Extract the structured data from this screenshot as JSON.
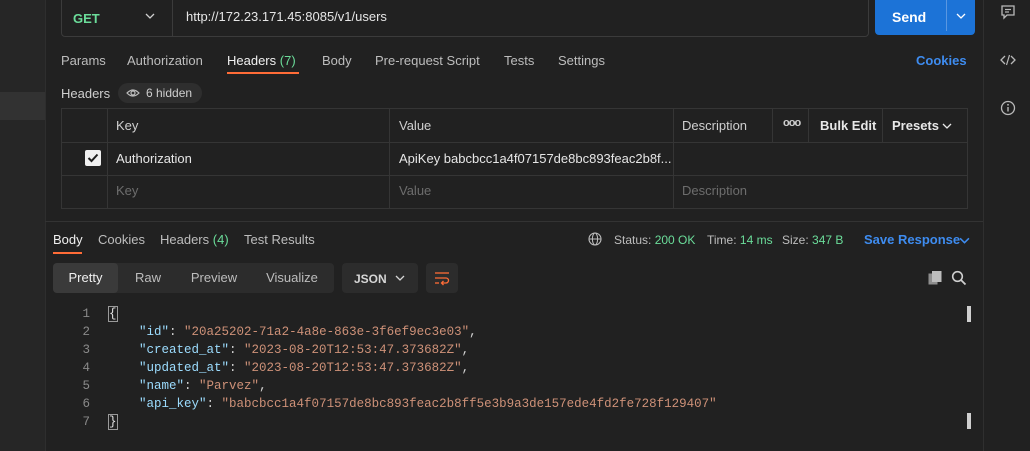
{
  "request": {
    "method": "GET",
    "url": "http://172.23.171.45:8085/v1/users",
    "send_label": "Send",
    "tabs": [
      {
        "label": "Params"
      },
      {
        "label": "Authorization"
      },
      {
        "label": "Headers",
        "count": "(7)"
      },
      {
        "label": "Body"
      },
      {
        "label": "Pre-request Script"
      },
      {
        "label": "Tests"
      },
      {
        "label": "Settings"
      }
    ],
    "cookies_label": "Cookies"
  },
  "headers_section": {
    "title": "Headers",
    "hidden_label": "6 hidden",
    "columns": {
      "key": "Key",
      "value": "Value",
      "description": "Description",
      "more": "ooo",
      "bulk_edit": "Bulk Edit",
      "presets": "Presets"
    },
    "rows": [
      {
        "checked": true,
        "key": "Authorization",
        "value": "ApiKey babcbcc1a4f07157de8bc893feac2b8f...",
        "description": ""
      }
    ],
    "placeholder": {
      "key": "Key",
      "value": "Value",
      "description": "Description"
    }
  },
  "response": {
    "tabs": [
      {
        "label": "Body"
      },
      {
        "label": "Cookies"
      },
      {
        "label": "Headers",
        "count": "(4)"
      },
      {
        "label": "Test Results"
      }
    ],
    "status_label": "Status:",
    "status_value": "200 OK",
    "time_label": "Time:",
    "time_value": "14 ms",
    "size_label": "Size:",
    "size_value": "347 B",
    "save_label": "Save Response",
    "view_modes": [
      "Pretty",
      "Raw",
      "Preview",
      "Visualize"
    ],
    "active_view": "Pretty",
    "format": "JSON",
    "body_lines": [
      {
        "n": "1",
        "open": "{"
      },
      {
        "n": "2",
        "key": "\"id\"",
        "val": "\"20a25202-71a2-4a8e-863e-3f6ef9ec3e03\""
      },
      {
        "n": "3",
        "key": "\"created_at\"",
        "val": "\"2023-08-20T12:53:47.373682Z\""
      },
      {
        "n": "4",
        "key": "\"updated_at\"",
        "val": "\"2023-08-20T12:53:47.373682Z\""
      },
      {
        "n": "5",
        "key": "\"name\"",
        "val": "\"Parvez\""
      },
      {
        "n": "6",
        "key": "\"api_key\"",
        "val": "\"babcbcc1a4f07157de8bc893feac2b8ff5e3b9a3de157ede4fd2fe728f129407\""
      },
      {
        "n": "7",
        "close": "}"
      }
    ]
  },
  "colors": {
    "accent": "#ff6c37",
    "send": "#1c73d7",
    "success": "#6bdd9a",
    "link": "#3e8cf0"
  }
}
